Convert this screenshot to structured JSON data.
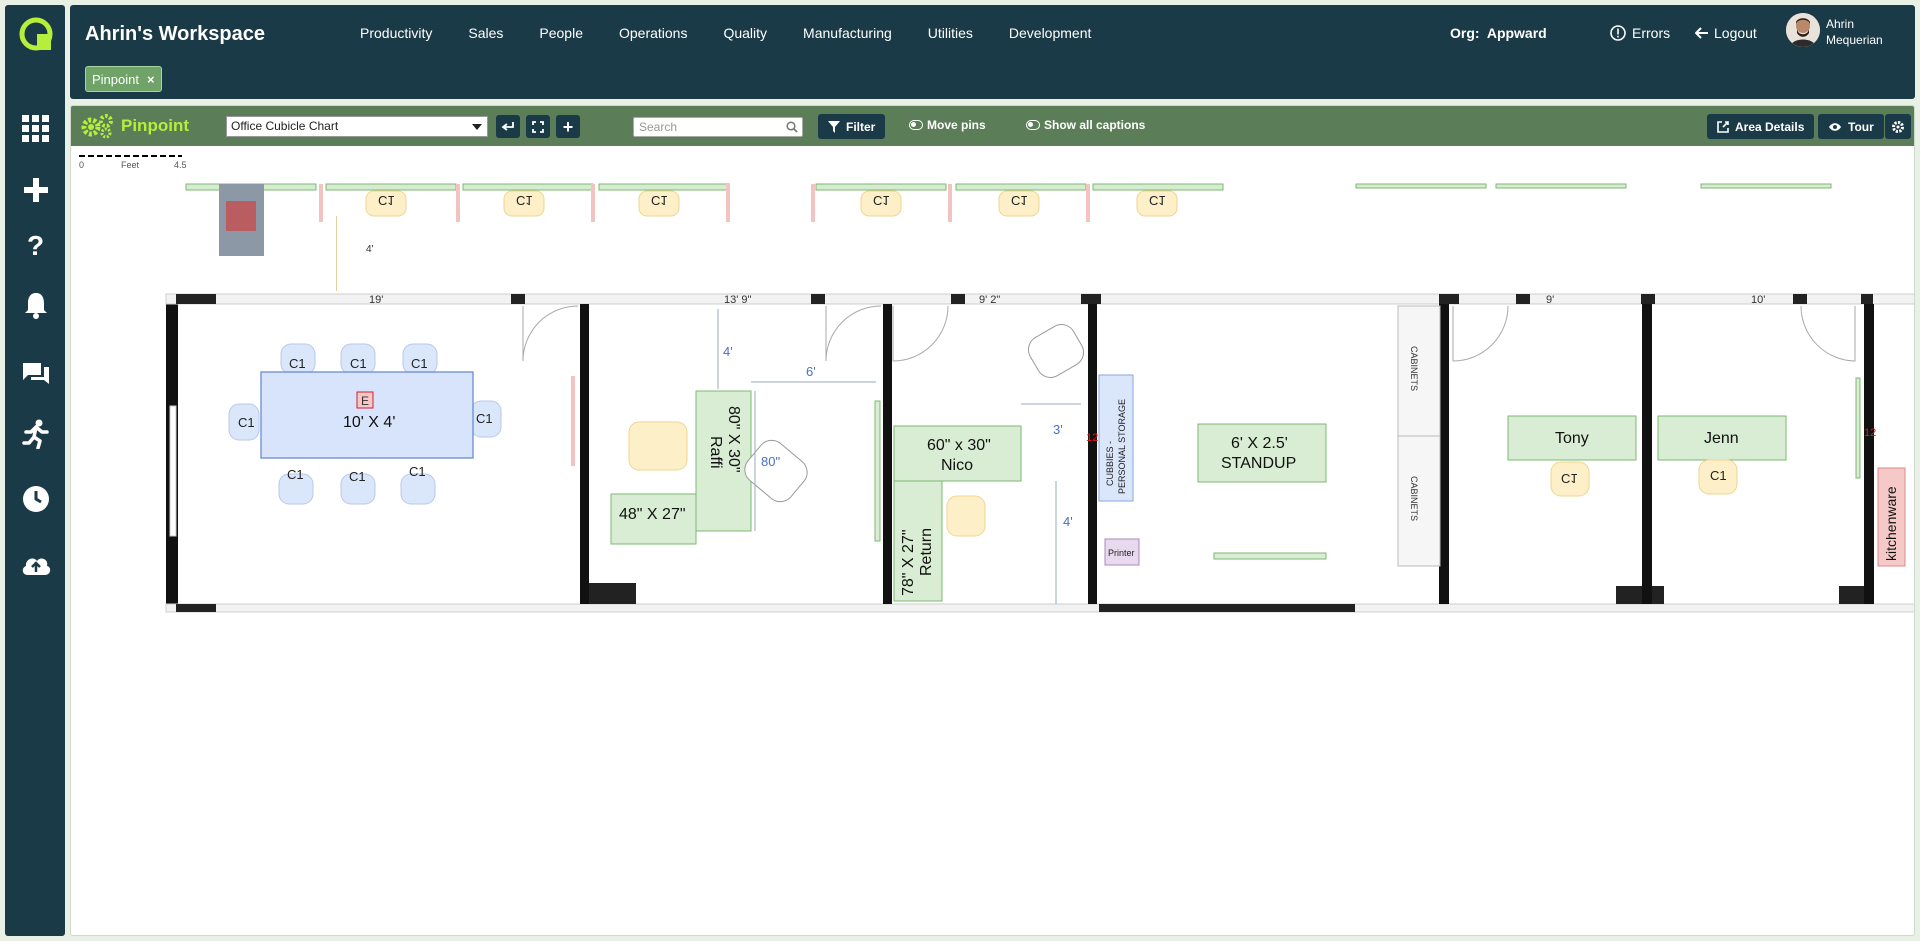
{
  "header": {
    "workspace_title": "Ahrin's Workspace",
    "nav": [
      "Productivity",
      "Sales",
      "People",
      "Operations",
      "Quality",
      "Manufacturing",
      "Utilities",
      "Development"
    ],
    "org_label": "Org:",
    "org_name": "Appward",
    "errors": "Errors",
    "logout": "Logout",
    "user_name": "Ahrin Mequerian",
    "chip": "Pinpoint"
  },
  "toolbar": {
    "title": "Pinpoint",
    "chart_select": "Office Cubicle Chart",
    "search_placeholder": "Search",
    "filter": "Filter",
    "move_pins": "Move pins",
    "show_captions": "Show all captions",
    "area_details": "Area Details",
    "tour": "Tour"
  },
  "scale": {
    "start": "0",
    "unit": "Feet",
    "end": "4.5"
  },
  "floorplan": {
    "dims": [
      "19'",
      "13' 9\"",
      "9' 2\"",
      "9'",
      "10'"
    ],
    "conference_table": "10' X 4'",
    "chairs": "C1",
    "exit_marker": "E",
    "desk_raffi": [
      "80\" X 30\"",
      "Raffi"
    ],
    "desk_48": "48\" X 27\"",
    "dim_4a": "4'",
    "dim_6": "6'",
    "dim_80": "80\"",
    "desk_nico": [
      "60\" x 30\"",
      "Nico"
    ],
    "return": [
      "78\" X 27\"",
      "Return"
    ],
    "dim_3": "3'",
    "dim_4b": "4'",
    "cubbies": [
      "CUBBIES -",
      "PERSONAL STORAGE"
    ],
    "printer": "Printer",
    "standup": [
      "6' X 2.5'",
      "STANDUP"
    ],
    "cabinets": "CABINETS",
    "tony": "Tony",
    "jenn": "Jenn",
    "kitchenware": "kitchenware",
    "red_12": "12",
    "top_4": "4'"
  }
}
